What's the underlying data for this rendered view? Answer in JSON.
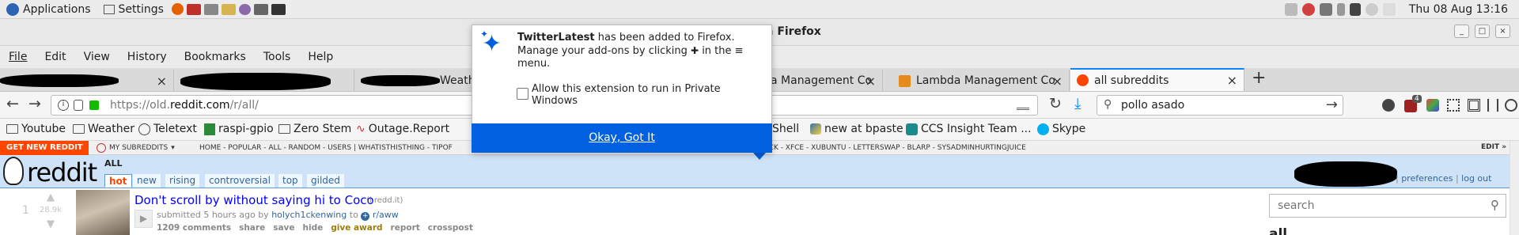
{
  "panel": {
    "applications": "Applications",
    "settings": "Settings",
    "clock": "Thu 08 Aug 13:16"
  },
  "window": {
    "title_fragment": "a Firefox",
    "minimize": "_",
    "maximize": "□",
    "close": "×"
  },
  "menubar": [
    "File",
    "Edit",
    "View",
    "History",
    "Bookmarks",
    "Tools",
    "Help"
  ],
  "tabs": [
    {
      "label": "Weathe"
    },
    {
      "label": "a Management Co"
    },
    {
      "label": "Lambda Management Co"
    },
    {
      "label": "all subreddits"
    }
  ],
  "nav": {
    "url_prefix": "https://old.",
    "url_domain": "reddit.com",
    "url_path": "/r/all/",
    "search_value": "pollo asado",
    "notif_badge": "4"
  },
  "bookmarks": [
    "Youtube",
    "Weather",
    "Teletext",
    "raspi-gpio",
    "Zero Stem",
    "Outage.Report",
    "Shell",
    "new at bpaste",
    "CCS Insight Team ...",
    "Skype"
  ],
  "reddit": {
    "get_new": "GET NEW REDDIT",
    "my_subreddits": "MY SUBREDDITS",
    "sr_left": "HOME - POPULAR - ALL - RANDOM - USERS | WHATISTHISTHING - TIPOF",
    "sr_right": "ICK - XFCE - XUBUNTU - LETTERSWAP - BLARP - SYSADMINHURTINGJUICE",
    "edit": "EDIT »",
    "logo": "reddit",
    "page_name": "ALL",
    "sort_tabs": [
      "hot",
      "new",
      "rising",
      "controversial",
      "top",
      "gilded"
    ],
    "preferences": "preferences",
    "logout": "log out",
    "search_placeholder": "search",
    "side_heading": "all"
  },
  "post": {
    "rank": "1",
    "score": "28.9k",
    "title": "Don't scroll by without saying hi to Coco",
    "domain": "(i.redd.it)",
    "submitted": "submitted 5 hours ago by",
    "author": "holych1ckenwing",
    "to": "to",
    "subreddit": "r/aww",
    "actions": [
      "1209 comments",
      "share",
      "save",
      "hide",
      "give award",
      "report",
      "crosspost"
    ]
  },
  "popup": {
    "name": "TwitterLatest",
    "line1_rest": " has been added to Firefox.",
    "line2_a": "Manage your add-ons by clicking ",
    "line2_b": " in the ",
    "line3": "menu.",
    "checkbox_label": "Allow this extension to run in Private Windows",
    "ok_button": "Okay, Got It"
  },
  "colors": {
    "accent": "#0060df",
    "reddit_orange": "#ff4500",
    "reddit_header": "#cee3f8",
    "link": "#0000ff"
  }
}
